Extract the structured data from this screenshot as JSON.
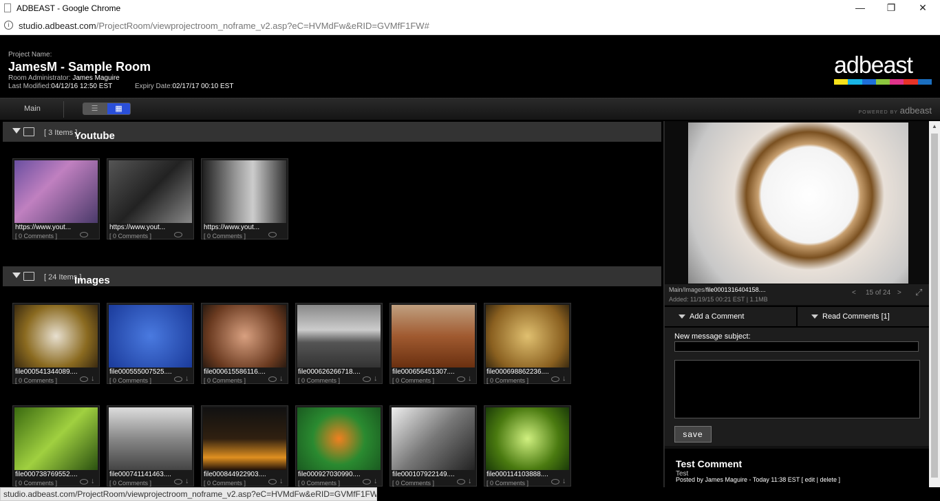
{
  "browser": {
    "title": "ADBEAST - Google Chrome",
    "url_host": "studio.adbeast.com",
    "url_path": "/ProjectRoom/viewprojectroom_noframe_v2.asp?eC=HVMdFw&eRID=GVMfF1FW#",
    "controls": {
      "minimize": "—",
      "maximize": "❐",
      "close": "✕"
    }
  },
  "header": {
    "project_label": "Project Name:",
    "project_name": "JamesM - Sample Room",
    "admin_label": "Room Administrator:",
    "admin_name": "James Maguire",
    "modified_label": "Last Modified:",
    "modified_value": "04/12/16 12:50 EST",
    "expiry_label": "Expiry Date:",
    "expiry_value": "02/17/17 00:10 EST",
    "logo_text": "adbeast",
    "logo_colors": [
      "#f7e11b",
      "#19b5e6",
      "#1d6fd8",
      "#8dc63f",
      "#e0348b",
      "#e63327",
      "#1b6fc0"
    ]
  },
  "nav": {
    "main_tab": "Main",
    "list_icon": "☰",
    "grid_icon": "▦",
    "powered_by": "POWERED BY",
    "powered_brand": "adbeast"
  },
  "folders": [
    {
      "name": "Youtube",
      "count": "[ 3 Items ]",
      "items": [
        {
          "caption": "https://www.yout...",
          "comments": "[ 0 Comments ]",
          "bg": "linear-gradient(135deg,#6a4fa0,#c080c0 40%,#4a3a6a)"
        },
        {
          "caption": "https://www.yout...",
          "comments": "[ 0 Comments ]",
          "bg": "linear-gradient(135deg,#555,#222 50%,#888)"
        },
        {
          "caption": "https://www.yout...",
          "comments": "[ 0 Comments ]",
          "bg": "linear-gradient(90deg,#222,#999 40%,#ccc 60%,#333)"
        }
      ]
    },
    {
      "name": "Images",
      "count": "[ 24 Items ]",
      "items": [
        {
          "caption": "file000541344089....",
          "comments": "[ 0 Comments ]",
          "bg": "radial-gradient(circle,#e8e0d0,#8a6a20 60%,#3a2a10)"
        },
        {
          "caption": "file000555007525....",
          "comments": "[ 0 Comments ]",
          "bg": "radial-gradient(circle,#4a7ae0,#1a3a9a)"
        },
        {
          "caption": "file000615586116....",
          "comments": "[ 0 Comments ]",
          "bg": "radial-gradient(circle,#d8a080,#6a3a20 70%,#2a1a10)"
        },
        {
          "caption": "file000626266718....",
          "comments": "[ 0 Comments ]",
          "bg": "linear-gradient(#888,#ccc 40%,#555 60%,#333)"
        },
        {
          "caption": "file000656451307....",
          "comments": "[ 0 Comments ]",
          "bg": "linear-gradient(#c0a080,#a05a30 50%,#6a3010)"
        },
        {
          "caption": "file000698862236....",
          "comments": "[ 0 Comments ]",
          "bg": "radial-gradient(circle,#e0c070,#8a6020 70%,#3a2a10)"
        },
        {
          "caption": "file000738769552....",
          "comments": "[ 0 Comments ]",
          "bg": "linear-gradient(135deg,#3a6a10,#a0d040 50%,#2a5010)"
        },
        {
          "caption": "file000741141463....",
          "comments": "[ 0 Comments ]",
          "bg": "linear-gradient(#ddd,#888 50%,#444)"
        },
        {
          "caption": "file000844922903....",
          "comments": "[ 0 Comments ]",
          "bg": "linear-gradient(#111,#302010 50%,#e09020 80%,#201008)"
        },
        {
          "caption": "file000927030990....",
          "comments": "[ 0 Comments ]",
          "bg": "radial-gradient(circle,#f08020,#2a8a30 50%,#1a5a20)"
        },
        {
          "caption": "file000107922149....",
          "comments": "[ 0 Comments ]",
          "bg": "linear-gradient(135deg,#eee,#777 50%,#222)"
        },
        {
          "caption": "file000114103888....",
          "comments": "[ 0 Comments ]",
          "bg": "radial-gradient(circle,#d0f080,#4a7a10 60%,#1a3a08)"
        }
      ]
    }
  ],
  "preview": {
    "path_prefix": "Main/Images/",
    "filename": "file0001316404158....",
    "added": "Added: 11/19/15 00:21 EST  |  1.1MB",
    "position": "15 of 24",
    "prev": "<",
    "next": ">",
    "fullscreen": "⤢"
  },
  "comments": {
    "add_tab": "Add a Comment",
    "read_tab": "Read Comments [1]",
    "subject_label": "New message subject:",
    "save": "save",
    "title": "Test Comment",
    "body": "Test",
    "posted": "Posted by James Maguire - Today 11:38 EST [ edit | delete ]"
  },
  "status_bar": "studio.adbeast.com/ProjectRoom/viewprojectroom_noframe_v2.asp?eC=HVMdFw&eRID=GVMfF1FW#"
}
